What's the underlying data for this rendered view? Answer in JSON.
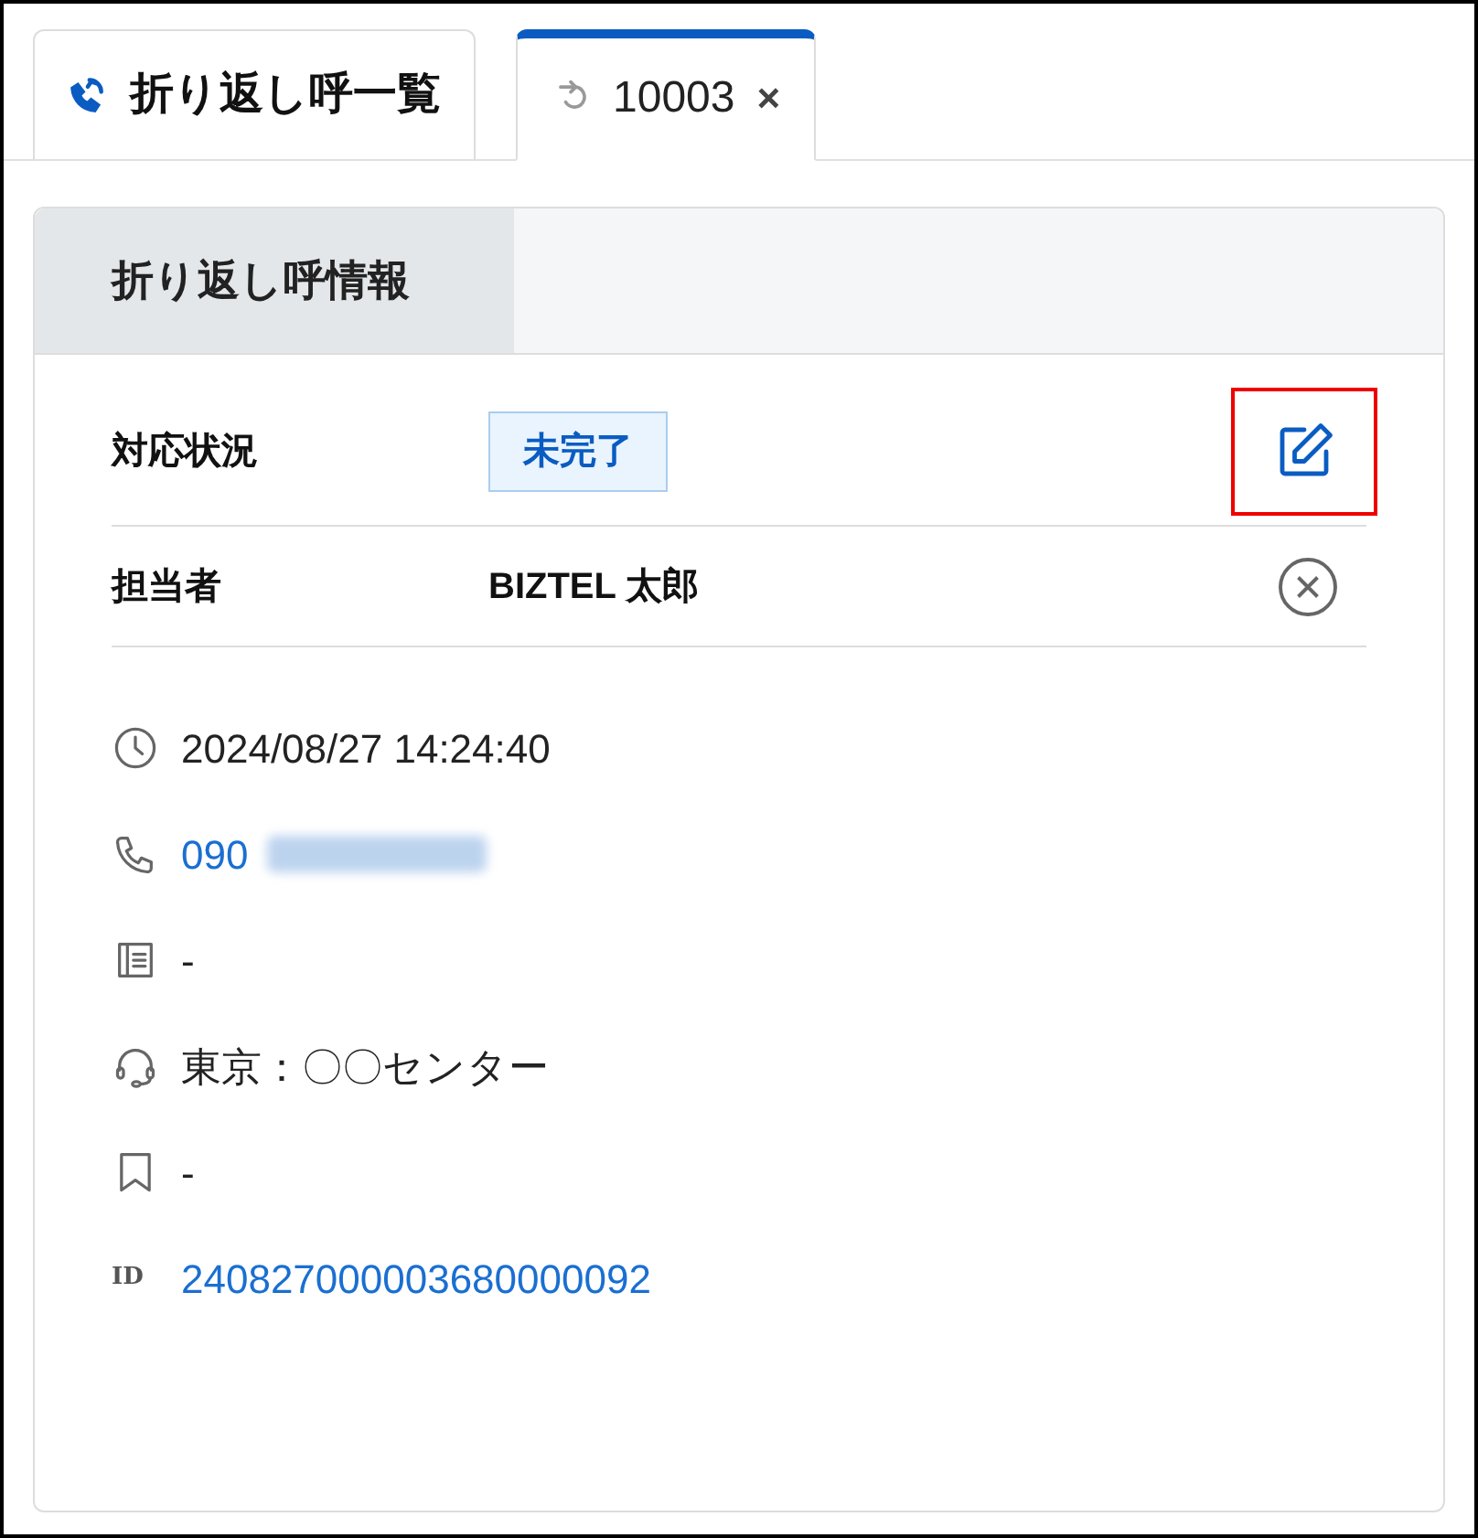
{
  "tabs": [
    {
      "label": "折り返し呼一覧",
      "kind": "list",
      "selected": false
    },
    {
      "label": "10003",
      "kind": "detail",
      "selected": true,
      "close": "×"
    }
  ],
  "panel": {
    "tabs": [
      {
        "label": "折り返し呼情報",
        "selected": true
      }
    ],
    "fields": [
      {
        "label": "対応状況",
        "kind": "status",
        "value": "未完了",
        "highlighted_action": true
      },
      {
        "label": "担当者",
        "kind": "assignee",
        "value": "BIZTEL 太郎"
      }
    ],
    "details": [
      {
        "kind": "clock",
        "text": "2024/08/27 14:24:40",
        "link": false
      },
      {
        "kind": "phone",
        "text": "090",
        "link": true,
        "redacted": true
      },
      {
        "kind": "note",
        "text": "-",
        "link": false
      },
      {
        "kind": "headset",
        "text": "東京：〇〇センター",
        "link": false
      },
      {
        "kind": "bookmark",
        "text": "-",
        "link": false
      },
      {
        "kind": "id",
        "badge": "ID",
        "text": "240827000003680000092",
        "link": true
      }
    ]
  }
}
